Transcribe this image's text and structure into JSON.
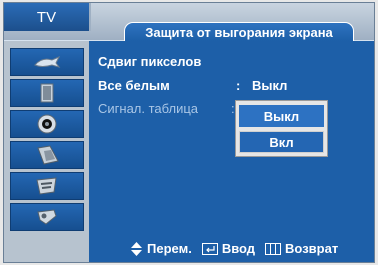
{
  "header": {
    "source": "TV",
    "menu_title": "Защита от выгорания экрана"
  },
  "nav_icons": [
    "picture-icon",
    "sound-icon",
    "channel-icon",
    "setup-icon",
    "input-icon",
    "application-icon"
  ],
  "menu": {
    "rows": [
      {
        "label": "Сдвиг пикселов"
      },
      {
        "label": "Все белым",
        "colon": ":",
        "value": "Выкл"
      },
      {
        "label": "Сигнал. таблица",
        "colon": ":"
      }
    ]
  },
  "popup": {
    "options": [
      "Выкл",
      "Вкл"
    ],
    "selected": "Выкл"
  },
  "footer": {
    "move_label": "Перем.",
    "enter_label": "Ввод",
    "return_label": "Возврат"
  },
  "colors": {
    "osd_blue": "#1d5fa8",
    "side_grey": "#b7c3cf",
    "highlight_blue": "#2d72c2"
  }
}
